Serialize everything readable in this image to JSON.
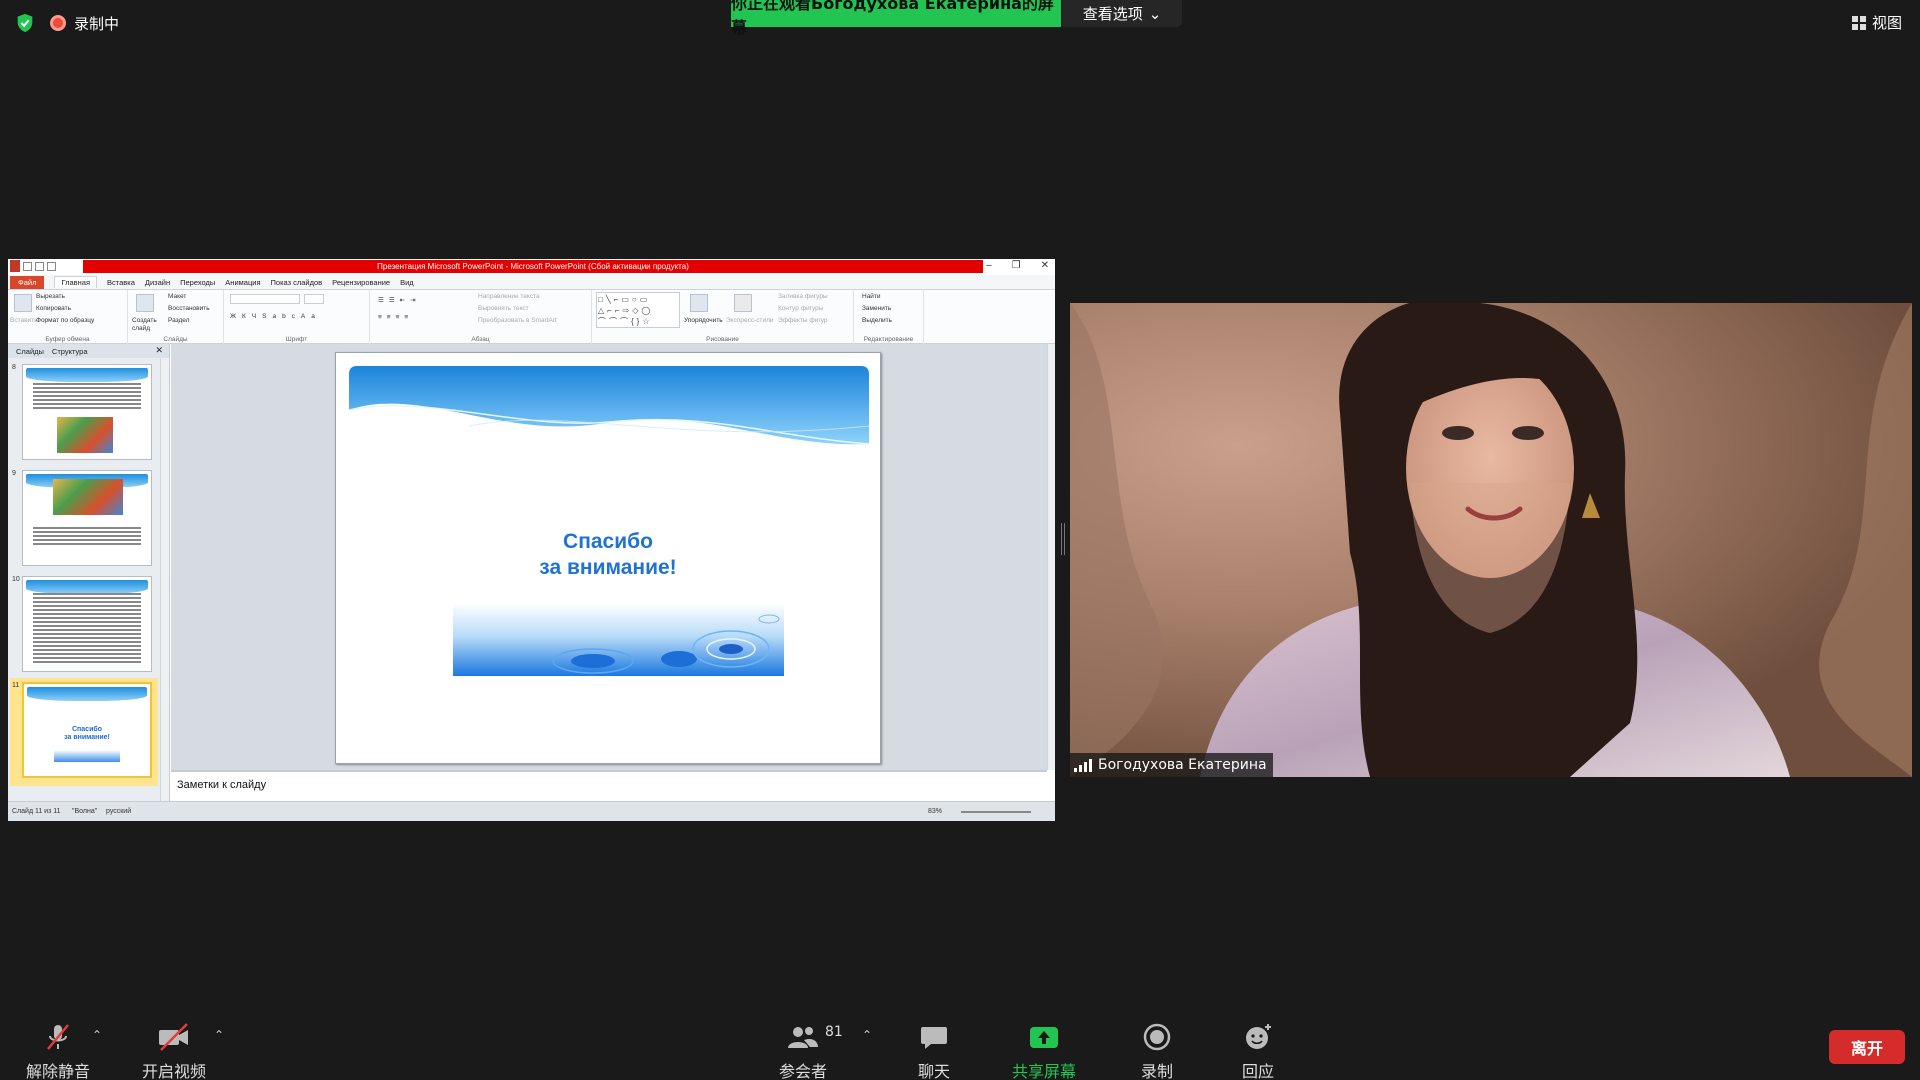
{
  "meeting": {
    "recording_label": "录制中",
    "share_banner": "你正在观看Богодухова  Екатерина的屏幕",
    "view_options_label": "查看选项",
    "view_label": "视图",
    "colors": {
      "accent_green": "#23c552",
      "leave_red": "#d62b2b",
      "background": "#1a1a1a"
    }
  },
  "ppt": {
    "window_title": "Презентация Microsoft PowerPoint - Microsoft PowerPoint (Сбой активации продукта)",
    "tabs": [
      "Файл",
      "Главная",
      "Вставка",
      "Дизайн",
      "Переходы",
      "Анимация",
      "Показ слайдов",
      "Рецензирование",
      "Вид"
    ],
    "ribbon": {
      "clipboard": {
        "paste": "Вставить",
        "cut": "Вырезать",
        "copy": "Копировать",
        "format_painter": "Формат по образцу",
        "label": "Буфер обмена"
      },
      "slides": {
        "new_slide": "Создать слайд",
        "layout": "Макет",
        "reset": "Восстановить",
        "section": "Раздел",
        "label": "Слайды"
      },
      "font": {
        "label": "Шрифт"
      },
      "paragraph": {
        "text_direction": "Направление текста",
        "align_text": "Выровнять текст",
        "smartart": "Преобразовать в SmartArt",
        "label": "Абзац"
      },
      "drawing": {
        "arrange": "Упорядочить",
        "quick_styles": "Экспресс-стили",
        "shape_fill": "Заливка фигуры",
        "shape_outline": "Контур фигуры",
        "shape_effects": "Эффекты фигур",
        "label": "Рисование"
      },
      "editing": {
        "find": "Найти",
        "replace": "Заменить",
        "select": "Выделить",
        "label": "Редактирование"
      }
    },
    "pane_tabs": [
      "Слайды",
      "Структура"
    ],
    "thumbnails": [
      {
        "num": "8"
      },
      {
        "num": "9"
      },
      {
        "num": "10"
      },
      {
        "num": "11",
        "title_line1": "Спасибо",
        "title_line2": "за внимание!"
      }
    ],
    "slide": {
      "line1": "Спасибо",
      "line2": "за внимание!"
    },
    "notes_placeholder": "Заметки к слайду",
    "status": {
      "slide_info": "Слайд 11 из 11",
      "theme": "\"Волна\"",
      "language": "русский",
      "zoom": "83%"
    }
  },
  "participant": {
    "name": "Богодухова Екатерина"
  },
  "toolbar": {
    "unmute": "解除静音",
    "start_video": "开启视频",
    "participants": "参会者",
    "participants_count": "81",
    "chat": "聊天",
    "share_screen": "共享屏幕",
    "record": "录制",
    "reactions": "回应",
    "leave": "离开"
  }
}
